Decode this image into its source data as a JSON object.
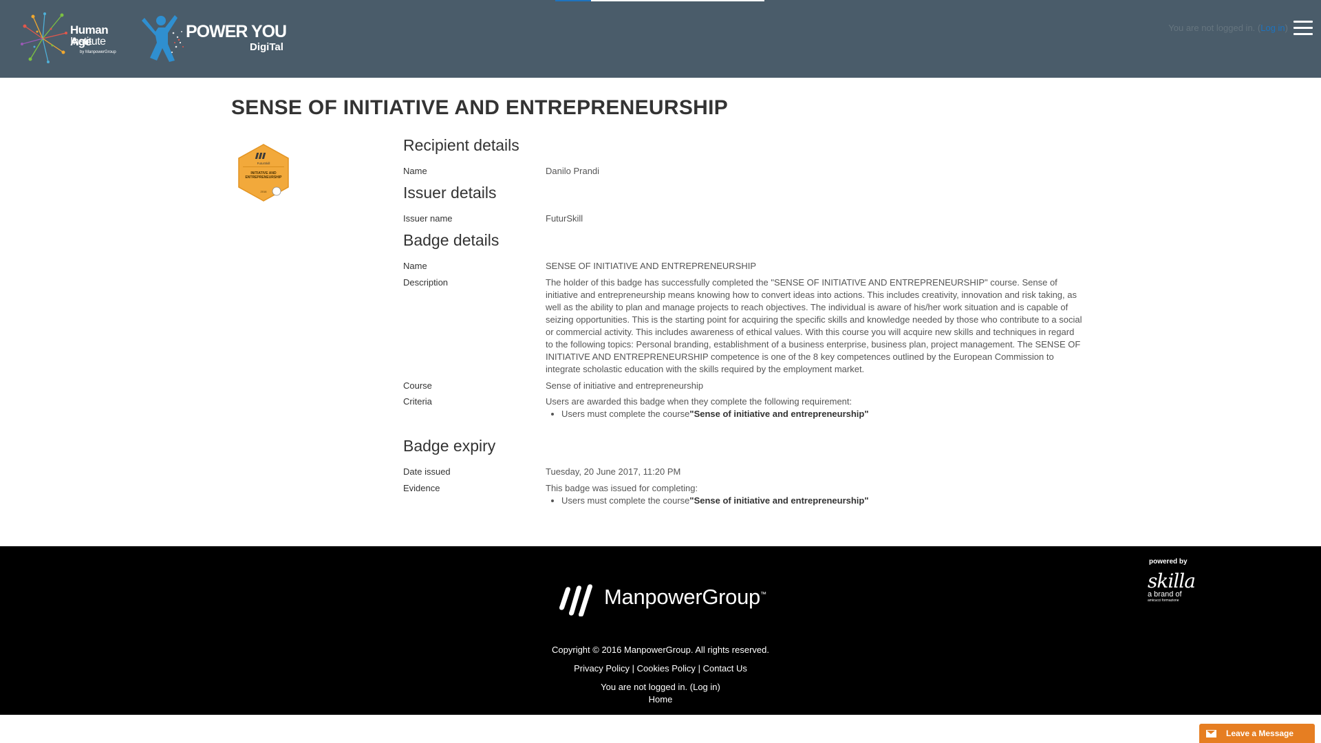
{
  "header": {
    "logo_hai": {
      "line1": "Human Age",
      "line2": "Institute",
      "sub": "by ManpowerGroup"
    },
    "logo_py": {
      "title": "POWER YOU",
      "sub": "DigiTal"
    },
    "login_status": {
      "prefix": "You are not logged in. (",
      "link": "Log in",
      "suffix": ")"
    },
    "progress_fraction": 0.17,
    "colors": {
      "bar": "#4a5c6a",
      "accent": "#1e73be"
    }
  },
  "page": {
    "title": "SENSE OF INITIATIVE AND ENTREPRENEURSHIP",
    "badge": {
      "org": "FuturSkill",
      "label_line1": "INITIATIVE AND",
      "label_line2": "ENTREPRENEURSHIP",
      "year": "2016",
      "color": "#f2a93b"
    }
  },
  "recipient": {
    "heading": "Recipient details",
    "name_label": "Name",
    "name_value": "Danilo Prandi"
  },
  "issuer": {
    "heading": "Issuer details",
    "name_label": "Issuer name",
    "name_value": "FuturSkill"
  },
  "badge_details": {
    "heading": "Badge details",
    "name_label": "Name",
    "name_value": "SENSE OF INITIATIVE AND ENTREPRENEURSHIP",
    "description_label": "Description",
    "description_value": "The holder of this badge has successfully completed the \"SENSE OF INITIATIVE AND ENTREPRENEURSHIP\" course. Sense of initiative and entrepreneurship means knowing how to convert ideas into actions. This includes creativity, innovation and risk taking, as well as the ability to plan and manage projects to reach objectives. The individual is aware of his/her work situation and is capable of seizing opportunities. This is the starting point for acquiring the specific skills and knowledge needed by those who contribute to a social or commercial activity. This includes awareness of ethical values. With this course you will acquire new skills and techniques in regard to the following topics: Personal branding, establishment of a business enterprise, business plan, project management. The SENSE OF INITIATIVE AND ENTREPRENEURSHIP competence is one of the 8 key competences outlined by the European Commission to integrate scholastic education with the skills required by the employment market.",
    "course_label": "Course",
    "course_value": "Sense of initiative and entrepreneurship",
    "criteria_label": "Criteria",
    "criteria_intro": "Users are awarded this badge when they complete the following requirement:",
    "criteria_item_prefix": "Users must complete the course",
    "criteria_item_bold": "\"Sense of initiative and entrepreneurship\""
  },
  "expiry": {
    "heading": "Badge expiry",
    "date_label": "Date issued",
    "date_value": "Tuesday, 20 June 2017, 11:20 PM",
    "evidence_label": "Evidence",
    "evidence_intro": "This badge was issued for completing:",
    "evidence_item_prefix": "Users must complete the course",
    "evidence_item_bold": "\"Sense of initiative and entrepreneurship\""
  },
  "footer": {
    "logo_text": "ManpowerGroup",
    "logo_tm": "™",
    "copyright": "Copyright © 2016 ManpowerGroup. All rights reserved.",
    "links": [
      "Privacy Policy",
      "Cookies Policy",
      "Contact Us"
    ],
    "separator": "|",
    "login_status": "You are not logged in. (Log in)",
    "home": "Home",
    "powered_by": "powered by",
    "skilla_name": "skilla",
    "skilla_sub": "a brand of",
    "skilla_tiny": "amicucci formazione"
  },
  "chat": {
    "label": "Leave a Message",
    "color": "#e67e22"
  }
}
